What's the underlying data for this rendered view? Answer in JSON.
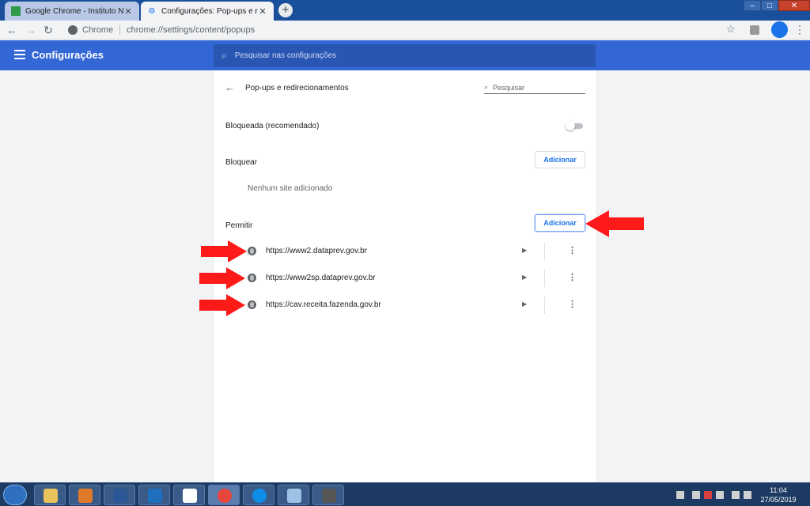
{
  "browser": {
    "tabs": [
      {
        "title": "Google Chrome - Instituto Nacio",
        "active": false
      },
      {
        "title": "Configurações: Pop-ups e redire",
        "active": true
      }
    ],
    "omnibox": {
      "chip": "Chrome",
      "url": "chrome://settings/content/popups"
    }
  },
  "settings_header": {
    "title": "Configurações",
    "search_placeholder": "Pesquisar nas configurações"
  },
  "page": {
    "title": "Pop-ups e redirecionamentos",
    "search_placeholder": "Pesquisar",
    "blocked_label": "Bloqueada (recomendado)",
    "toggle_on": false,
    "block_section": {
      "label": "Bloquear",
      "add_label": "Adicionar",
      "empty_text": "Nenhum site adicionado"
    },
    "allow_section": {
      "label": "Permitir",
      "add_label": "Adicionar",
      "sites": [
        "https://www2.dataprev.gov.br",
        "https://www2sp.dataprev.gov.br",
        "https://cav.receita.fazenda.gov.br"
      ]
    }
  },
  "taskbar": {
    "time": "11:04",
    "date": "27/05/2019"
  },
  "colors": {
    "header_blue": "#3367d6",
    "accent": "#1a73e8",
    "arrow_red": "#ff1a1a"
  },
  "icons": [
    "back-arrow-icon",
    "forward-arrow-icon",
    "reload-icon",
    "star-icon",
    "hamburger-icon",
    "search-icon",
    "globe-icon",
    "more-vert-icon",
    "caret-right-icon"
  ]
}
